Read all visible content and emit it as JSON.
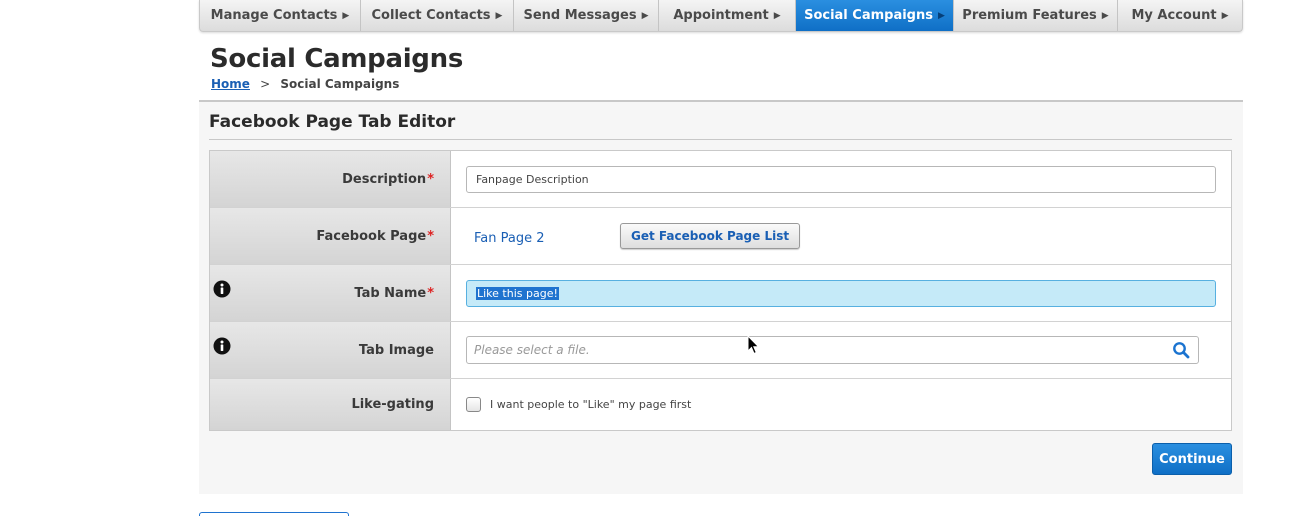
{
  "nav": {
    "tabs": [
      {
        "label": "Manage Contacts",
        "active": false
      },
      {
        "label": "Collect Contacts",
        "active": false
      },
      {
        "label": "Send Messages",
        "active": false
      },
      {
        "label": "Appointment",
        "active": false
      },
      {
        "label": "Social Campaigns",
        "active": true
      },
      {
        "label": "Premium Features",
        "active": false
      },
      {
        "label": "My Account",
        "active": false
      }
    ],
    "arrow": "▶"
  },
  "page": {
    "title": "Social Campaigns"
  },
  "breadcrumb": {
    "home": "Home",
    "separator": ">",
    "current": "Social Campaigns"
  },
  "section": {
    "title": "Facebook Page Tab Editor"
  },
  "form": {
    "required_mark": "*",
    "description": {
      "label": "Description",
      "value": "Fanpage Description"
    },
    "facebook_page": {
      "label": "Facebook Page",
      "value": "Fan Page 2",
      "button": "Get Facebook Page List"
    },
    "tab_name": {
      "label": "Tab Name",
      "value": "Like this page!"
    },
    "tab_image": {
      "label": "Tab Image",
      "placeholder": "Please select a file."
    },
    "like_gating": {
      "label": "Like-gating",
      "checkbox_label": "I want people to \"Like\" my page first",
      "checked": false
    }
  },
  "actions": {
    "continue": "Continue"
  },
  "icons": {
    "info": "info-icon",
    "search": "search-icon",
    "cursor": "mouse-pointer-icon"
  },
  "colors": {
    "accent": "#1a73d0",
    "required": "#dd2222",
    "link": "#1a5fb4"
  }
}
